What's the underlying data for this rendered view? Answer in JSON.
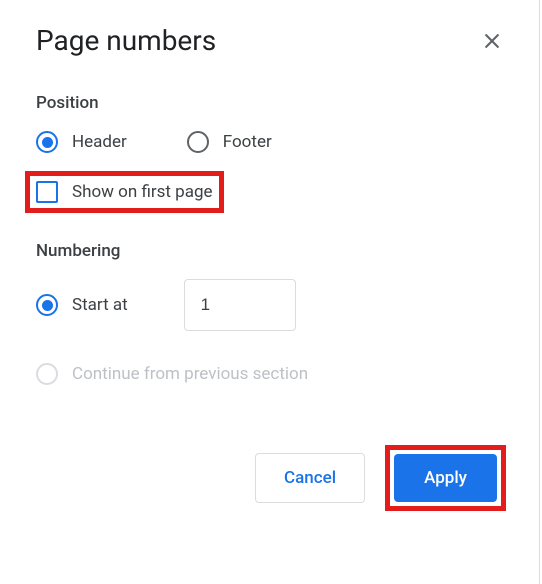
{
  "dialog": {
    "title": "Page numbers"
  },
  "position": {
    "label": "Position",
    "header": "Header",
    "footer": "Footer",
    "show_first_page": "Show on first page"
  },
  "numbering": {
    "label": "Numbering",
    "start_at": "Start at",
    "start_value": "1",
    "continue_prev": "Continue from previous section"
  },
  "actions": {
    "cancel": "Cancel",
    "apply": "Apply"
  }
}
